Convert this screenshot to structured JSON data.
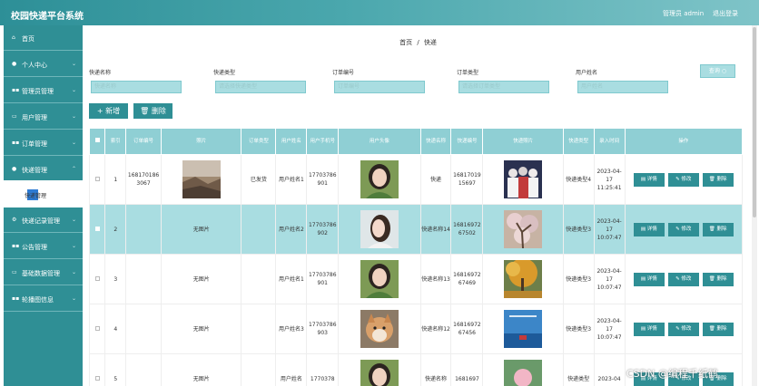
{
  "app": {
    "title": "校园快递平台系统",
    "admin": "管理员 admin",
    "logout": "退出登录"
  },
  "sidebar": {
    "items": [
      {
        "label": "首页",
        "icon": "home-icon"
      },
      {
        "label": "个人中心",
        "icon": "user-icon"
      },
      {
        "label": "管理员管理",
        "icon": "grid-icon"
      },
      {
        "label": "用户管理",
        "icon": "monitor-icon"
      },
      {
        "label": "订单管理",
        "icon": "grid-icon"
      },
      {
        "label": "快递管理",
        "icon": "pin-icon"
      },
      {
        "label": "快递记录管理",
        "icon": "gear-icon"
      },
      {
        "label": "公告管理",
        "icon": "grid-icon"
      },
      {
        "label": "基础数据管理",
        "icon": "monitor-icon"
      },
      {
        "label": "轮播图信息",
        "icon": "grid-icon"
      }
    ],
    "sub_item": "快递管理"
  },
  "breadcrumb": {
    "home": "首页",
    "sep": "/",
    "current": "快递"
  },
  "filters": [
    {
      "label": "快递名称",
      "placeholder": "快递名称"
    },
    {
      "label": "快递类型",
      "placeholder": "请选择快递类型"
    },
    {
      "label": "订单编号",
      "placeholder": "订单编号"
    },
    {
      "label": "订单类型",
      "placeholder": "请选择订单类型"
    },
    {
      "label": "用户姓名",
      "placeholder": "用户姓名"
    }
  ],
  "search_label": "查询",
  "toolbar": {
    "add_label": "+ 新增",
    "delete_label": "删除"
  },
  "table": {
    "headers": [
      "",
      "索引",
      "订单编号",
      "照片",
      "订单类型",
      "用户姓名",
      "用户手机号",
      "用户头像",
      "快递名称",
      "快递编号",
      "快递照片",
      "快递类型",
      "录入时间",
      "操作"
    ],
    "rows": [
      {
        "index": "1",
        "order_no": "1681701863067",
        "order_type": "已发货",
        "user_name": "用户姓名1",
        "phone": "17703786901",
        "express_name": "快递",
        "express_no": "1681701915697",
        "express_type": "快递类型4",
        "time": "2023-04-17 11:25:41",
        "photo_empty": ""
      },
      {
        "index": "2",
        "order_no": "",
        "order_type": "",
        "user_name": "用户姓名2",
        "phone": "17703786902",
        "express_name": "快递名称14",
        "express_no": "1681697267502",
        "express_type": "快递类型3",
        "time": "2023-04-17 10:07:47",
        "photo_empty": "无图片"
      },
      {
        "index": "3",
        "order_no": "",
        "order_type": "",
        "user_name": "用户姓名1",
        "phone": "17703786901",
        "express_name": "快递名称13",
        "express_no": "1681697267469",
        "express_type": "快递类型3",
        "time": "2023-04-17 10:07:47",
        "photo_empty": "无图片"
      },
      {
        "index": "4",
        "order_no": "",
        "order_type": "",
        "user_name": "用户姓名3",
        "phone": "17703786903",
        "express_name": "快递名称12",
        "express_no": "1681697267456",
        "express_type": "快递类型3",
        "time": "2023-04-17 10:07:47",
        "photo_empty": "无图片"
      },
      {
        "index": "5",
        "order_no": "",
        "order_type": "",
        "user_name": "用户姓名",
        "phone": "1770378",
        "express_name": "快递名称",
        "express_no": "1681697",
        "express_type": "快递类型",
        "time": "2023-04",
        "photo_empty": "无图片"
      }
    ],
    "ops": {
      "detail": "详情",
      "edit": "修改",
      "delete": "删除"
    }
  },
  "watermark": "CSDN @编程千纸鹤"
}
